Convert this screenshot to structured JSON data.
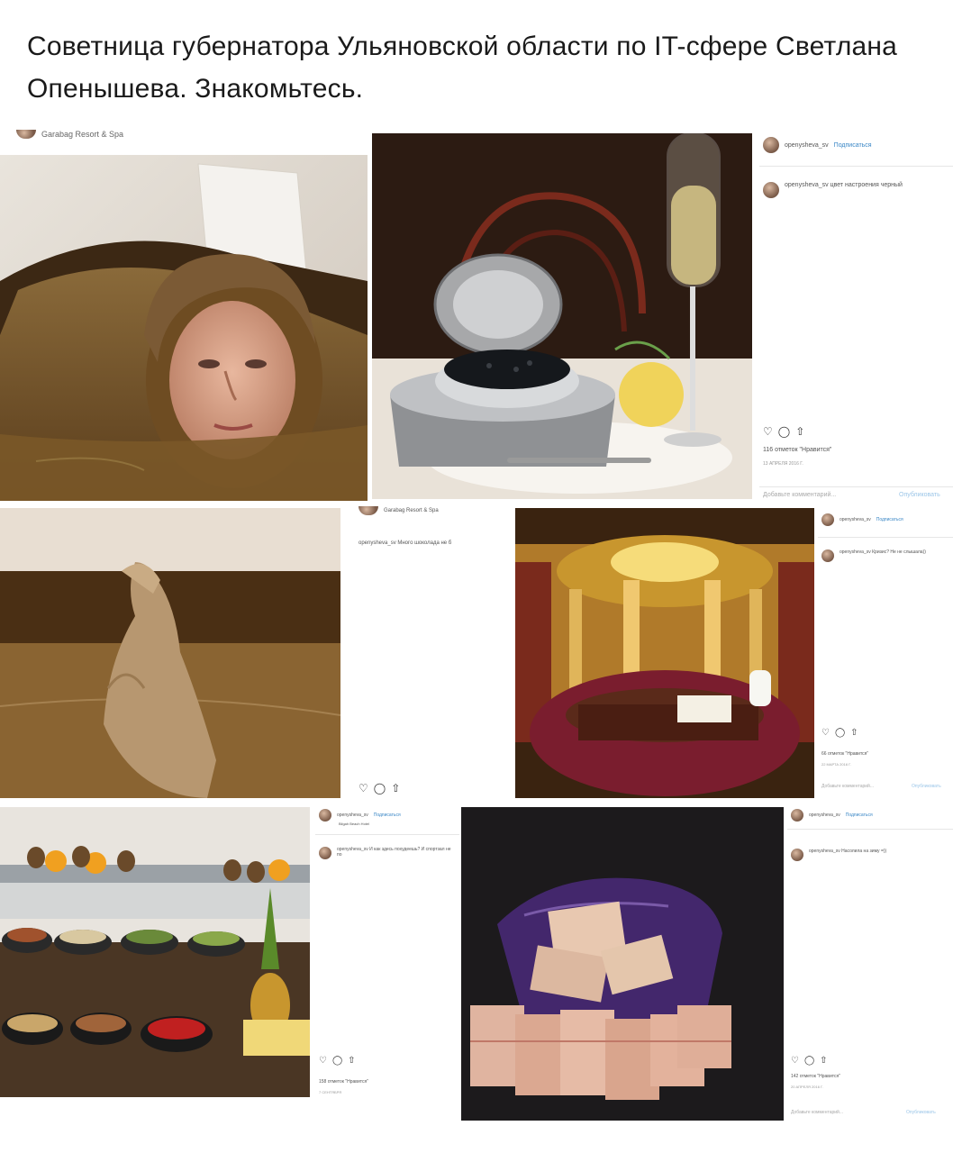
{
  "headline": "Советница губернатора Ульяновской области по IT-сфере Светлана Опенышева. Знакомьтесь.",
  "posts": {
    "p1": {
      "location": "Garabag Resort & Spa"
    },
    "p2": {
      "user": "openysheva_sv",
      "follow": "Подписаться",
      "caption": "openysheva_sv цвет настроения черный",
      "likes": "116 отметок \"Нравится\"",
      "date": "13 АПРЕЛЯ 2016 Г.",
      "add_comment": "Добавьте комментарий...",
      "publish": "Опубликовать"
    },
    "p3": {
      "location": "Garabag Resort & Spa",
      "caption": "openysheva_sv Много шоколада не б"
    },
    "p4": {
      "user": "openysheva_sv",
      "follow": "Подписаться",
      "caption": "openysheva_sv Кризис? Не не слышала))",
      "likes": "66 отметок \"Нравится\"",
      "date": "22 МАРТА 2016 Г.",
      "add_comment": "Добавьте комментарий...",
      "publish": "Опубликовать"
    },
    "p5": {
      "user": "openysheva_sv",
      "follow": "Подписаться",
      "location": "Bilgah Beach Hotel",
      "caption": "openysheva_sv И как здесь похудеешь? И спортзал не по",
      "likes": "158 отметок \"Нравится\"",
      "date": "7 СЕНТЯБРЯ"
    },
    "p6": {
      "user": "openysheva_sv",
      "follow": "Подписаться",
      "caption": "openysheva_sv Насолила на зиму =))",
      "likes": "142 отметок \"Нравится\"",
      "date": "20 АПРЕЛЯ 2016 Г.",
      "add_comment": "Добавьте комментарий...",
      "publish": "Опубликовать"
    }
  },
  "icons": {
    "like": "heart-icon",
    "comment": "comment-icon",
    "share": "share-icon"
  }
}
